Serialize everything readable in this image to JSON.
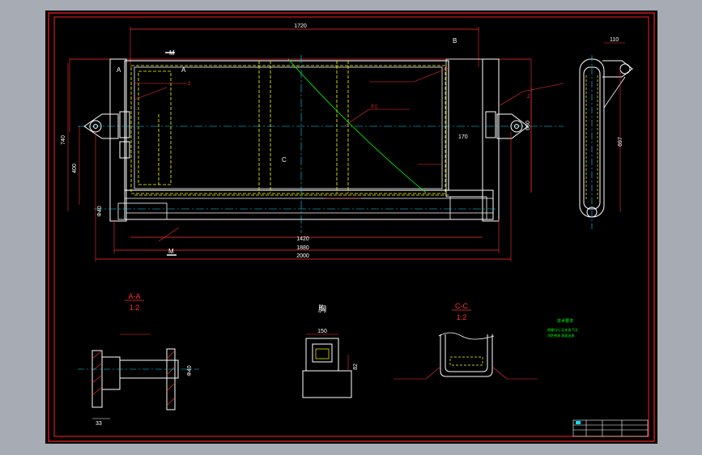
{
  "colors": {
    "background": "#000000",
    "frame": "#ff2020",
    "geometry": "#ffffff",
    "hidden": "#ffff00",
    "center": "#00e0ff",
    "dim": "#ff3030",
    "annot": "#ff3030",
    "green": "#00ff00",
    "bg_outer": "#a7abb3"
  },
  "main_view": {
    "dim_1720": "1720",
    "dim_1420": "1420",
    "dim_1880": "1880",
    "dim_2000": "2000",
    "dim_740": "740",
    "dim_400": "400",
    "dim_660": "660",
    "dim_170": "170",
    "dim_phi40": "Φ40",
    "label_A_left": "A",
    "label_A_right": "A",
    "label_M_top": "M",
    "label_M_bottom": "M",
    "label_B": "B",
    "label_C": "C",
    "callout_1": "2",
    "callout_2": "2",
    "weld_note": "3 ▯"
  },
  "side_view": {
    "dim_110": "110",
    "dim_697": "697"
  },
  "section_AA": {
    "title": "A-A",
    "scale": "1:2",
    "dim_33": "33",
    "dim_phi": "Φ40"
  },
  "section_detail": {
    "title": "胸",
    "dim_150": "150",
    "dim_82": "82"
  },
  "section_CC": {
    "title": "C-C",
    "scale": "1:2"
  },
  "notes": {
    "title": "技术要求",
    "line1": "焊缝均匀 无夹渣 气孔",
    "line2": "涂防锈漆 表面油漆"
  }
}
